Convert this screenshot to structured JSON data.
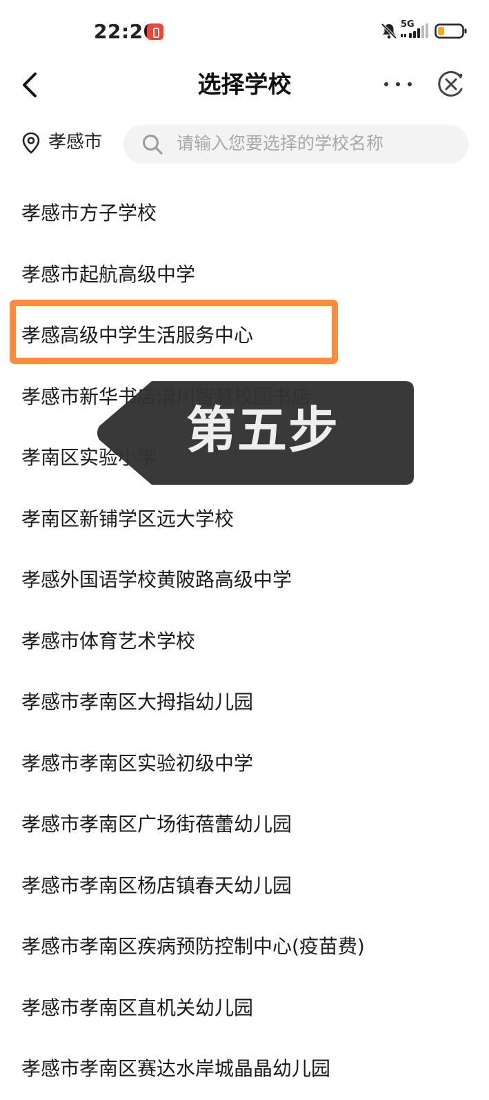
{
  "status_bar": {
    "time": "22:20",
    "network": "5G",
    "icons": [
      "notification-badge-icon",
      "mute-icon",
      "signal-icon",
      "battery-icon"
    ],
    "battery_color": "#f5a623"
  },
  "nav": {
    "title": "选择学校",
    "icons": [
      "back-icon",
      "more-icon",
      "close-icon"
    ]
  },
  "search": {
    "location": "孝感市",
    "placeholder": "请输入您要选择的学校名称"
  },
  "schools": [
    "孝感市方子学校",
    "孝感市起航高级中学",
    "孝感高级中学生活服务中心",
    "孝感市新华书店澴川智慧校园书店",
    "孝南区实验小学",
    "孝南区新铺学区远大学校",
    "孝感外国语学校黄陂路高级中学",
    "孝感市体育艺术学校",
    "孝感市孝南区大拇指幼儿园",
    "孝感市孝南区实验初级中学",
    "孝感市孝南区广场街蓓蕾幼儿园",
    "孝感市孝南区杨店镇春天幼儿园",
    "孝感市孝南区疾病预防控制中心(疫苗费)",
    "孝感市孝南区直机关幼儿园",
    "孝感市孝南区赛达水岸城晶晶幼儿园"
  ],
  "tutorial": {
    "step_label": "第五步",
    "highlight_color": "#fe8c3f",
    "tooltip_color": "#333333"
  }
}
